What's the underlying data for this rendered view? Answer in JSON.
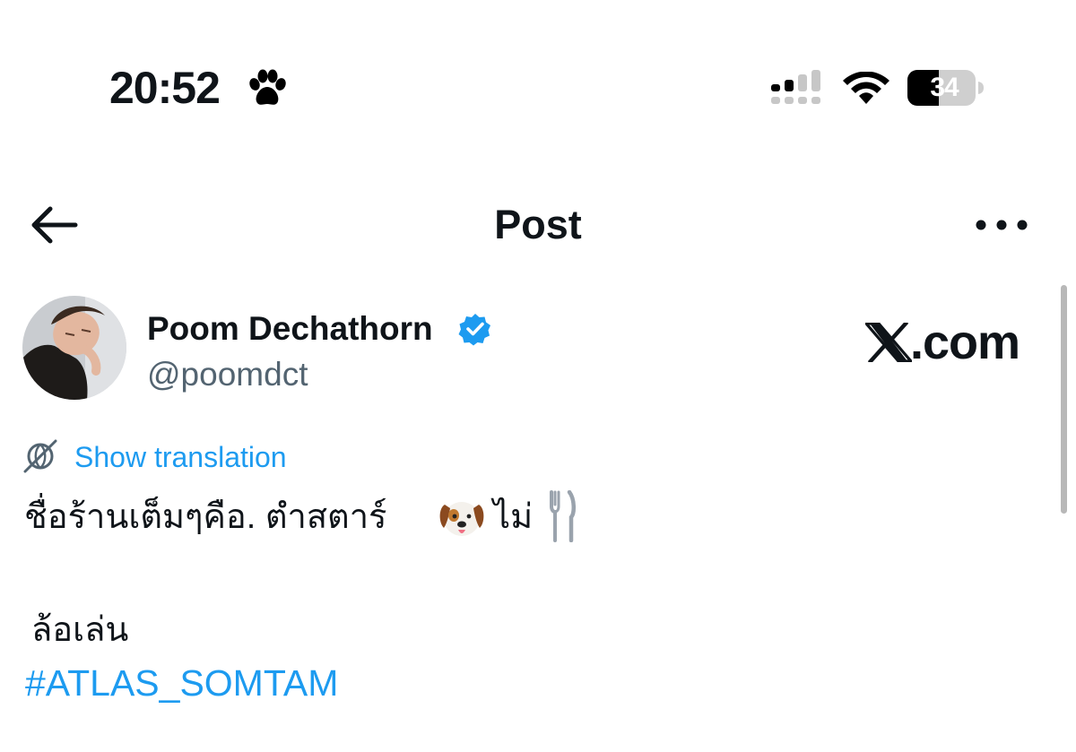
{
  "status_bar": {
    "time": "20:52",
    "focus_icon": "paw-print-icon",
    "battery_level": "34",
    "icons": [
      "signal-icon",
      "wifi-icon",
      "battery-icon"
    ]
  },
  "nav": {
    "back_icon": "arrow-left-icon",
    "title": "Post",
    "more_icon": "more-horizontal-icon"
  },
  "author": {
    "name": "Poom Dechathorn",
    "handle": "@poomdct",
    "verified": true,
    "verified_color": "#1d9bf0"
  },
  "watermark": {
    "logo": "x-logo-icon",
    "domain": ".com"
  },
  "translation": {
    "icon": "globe-icon",
    "label": "Show translation"
  },
  "post": {
    "line1": "ชื่อร้านเต็มๆคือ. ตำสตาร์",
    "line1_after_emoji": "ไม่",
    "emojis": [
      "dog-face-emoji",
      "fork-and-knife-emoji"
    ],
    "line2": "ล้อเล่น",
    "hashtag": "#ATLAS_SOMTAM"
  },
  "colors": {
    "text": "#0f1419",
    "secondary": "#536471",
    "accent": "#1d9bf0",
    "background": "#ffffff"
  }
}
